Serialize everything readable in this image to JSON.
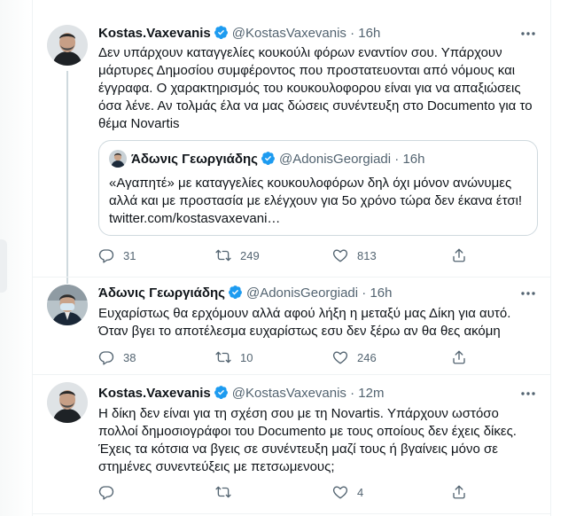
{
  "tweets": [
    {
      "name": "Kostas.Vaxevanis",
      "handle": "@KostasVaxevanis",
      "dot": "·",
      "time": "16h",
      "lines": [
        "Δεν υπάρχουν καταγγελίες κουκούλι φόρων εναντίον σου. Υπάρχουν",
        "μάρτυρες Δημοσίου συμφέροντος που προστατευονται από νόμους και",
        "έγγραφα. Ο χαρακτηρισμός του κουκουλοφορου είναι για να απαξιώσεις",
        "όσα λένε. Αν τολμάς έλα να μας δώσεις συνέντευξη στο Documento για το",
        "θέμα Novartis"
      ],
      "quote": {
        "name": "Άδωνις Γεωργιάδης",
        "handle": "@AdonisGeorgiadi",
        "dot": "·",
        "time": "16h",
        "lines": [
          "«Αγαπητέ» με καταγγελίες κουκουλοφόρων δηλ όχι μόνον ανώνυμες",
          "αλλά και με προστασία με ελέγχουν για 5ο χρόνο τώρα δεν έκανα έτσι!",
          "twitter.com/kostasvaxevani…"
        ]
      },
      "replies": "31",
      "retweets": "249",
      "likes": "813"
    },
    {
      "name": "Άδωνις Γεωργιάδης",
      "handle": "@AdonisGeorgiadi",
      "dot": "·",
      "time": "16h",
      "lines": [
        "Ευχαρίστως θα ερχόμουν αλλά αφού λήξη η μεταξύ μας Δίκη για αυτό.",
        "Όταν βγει το αποτέλεσμα ευχαρίστως εσυ δεν ξέρω αν θα θες ακόμη"
      ],
      "replies": "38",
      "retweets": "10",
      "likes": "246"
    },
    {
      "name": "Kostas.Vaxevanis",
      "handle": "@KostasVaxevanis",
      "dot": "·",
      "time": "12m",
      "lines": [
        "Η δίκη δεν είναι για τη σχέση σου με τη Novartis. Υπάρχουν ωστόσο",
        "πολλοί δημοσιογράφοι του Documento με τους οποίους δεν έχεις δίκες.",
        "Έχεις τα κότσια να βγεις σε συνέντευξη μαζί τους ή βγαίνεις μόνο σε",
        "στημένες συνεντεύξεις με πετσωμενους;"
      ],
      "replies": "",
      "retweets": "",
      "likes": "4"
    }
  ],
  "icons": {
    "verified": "verified-badge-icon",
    "reply": "reply-icon",
    "retweet": "retweet-icon",
    "like": "heart-icon",
    "share": "share-icon",
    "more": "more-icon"
  },
  "colors": {
    "verified": "#1d9bf0",
    "text": "#0f1419",
    "muted": "#536471",
    "border": "#cfd9de"
  }
}
